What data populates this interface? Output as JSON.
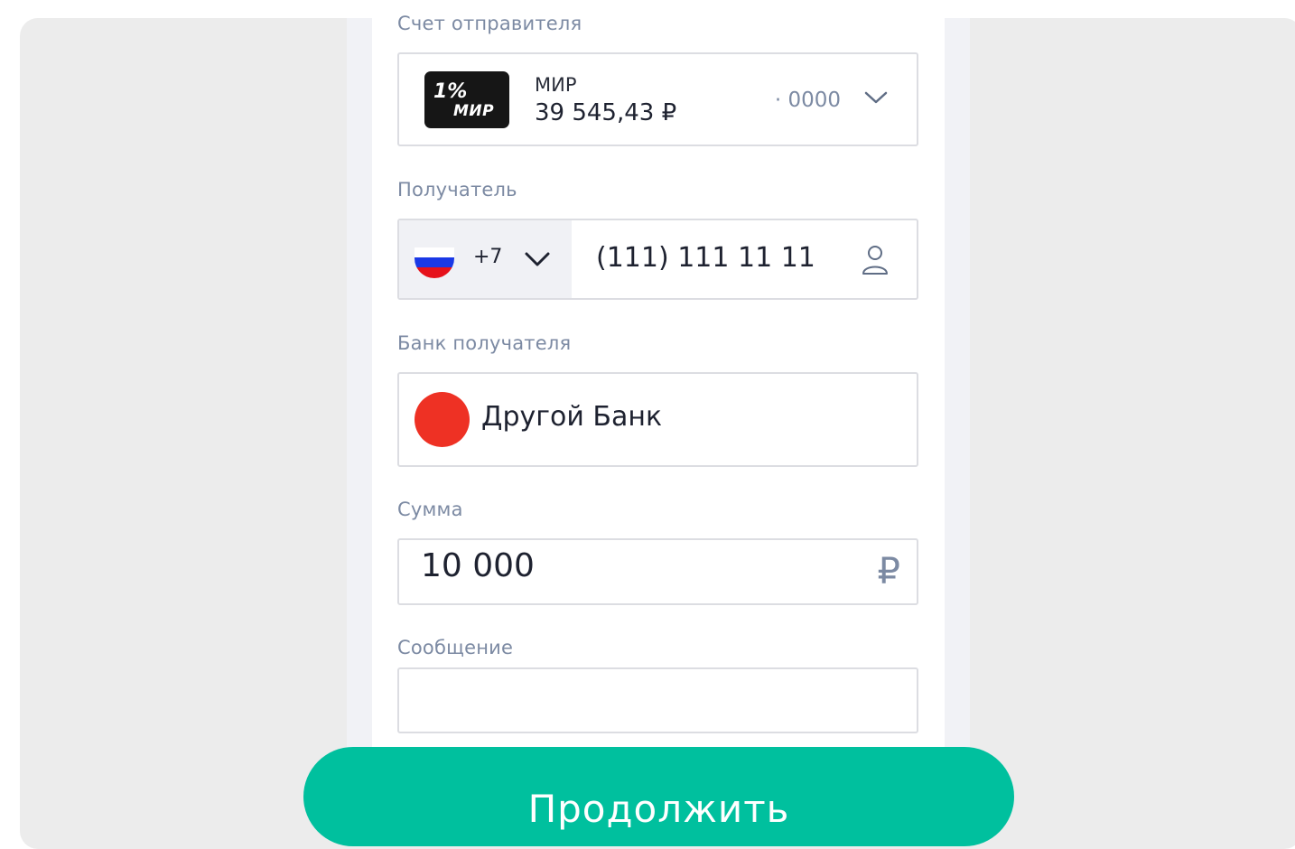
{
  "form": {
    "sender_label": "Счет отправителя",
    "account": {
      "logo_percent": "1%",
      "logo_mir": "МИР",
      "name": "МИР",
      "balance": "39 545,43 ₽",
      "number": "· 0000",
      "icon": "chevron-down-icon"
    },
    "recipient_label": "Получатель",
    "phone": {
      "country_code": "+7",
      "country_flag": "ru-flag-icon",
      "value": "(111) 111 11 11",
      "contacts_icon": "person-icon"
    },
    "bank_label": "Банк получателя",
    "bank": {
      "name": "Другой Банк",
      "logo_color": "#ee3124"
    },
    "amount_label": "Сумма",
    "amount": {
      "value": "10 000",
      "currency_symbol": "₽"
    },
    "message_label": "Сообщение",
    "message": {
      "value": ""
    }
  },
  "continue_label": "Продолжить",
  "colors": {
    "accent": "#00c09e",
    "label": "#7c8aa3",
    "text": "#1e2230",
    "border": "#dcdde2"
  }
}
